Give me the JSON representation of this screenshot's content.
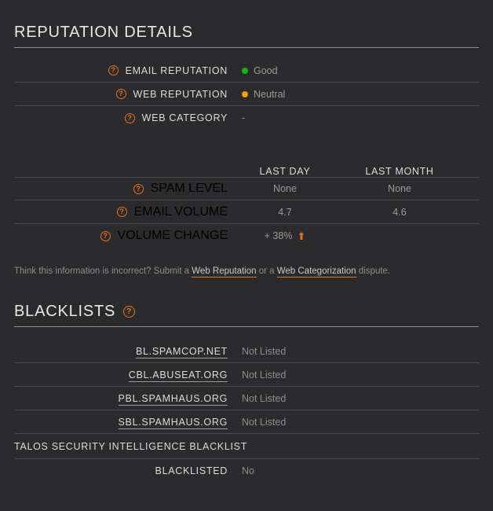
{
  "reputation_section": {
    "title": "REPUTATION DETAILS",
    "help_glyph": "?",
    "rows": [
      {
        "label": "EMAIL REPUTATION",
        "value": "Good",
        "dot_color": "#18b218"
      },
      {
        "label": "WEB REPUTATION",
        "value": "Neutral",
        "dot_color": "#e8a317"
      },
      {
        "label": "WEB CATEGORY",
        "value": "-",
        "dot_color": ""
      }
    ]
  },
  "metrics": {
    "columns": [
      "LAST DAY",
      "LAST MONTH"
    ],
    "rows": [
      {
        "label": "SPAM LEVEL",
        "last_day": "None",
        "last_month": "None",
        "arrow": ""
      },
      {
        "label": "EMAIL VOLUME",
        "last_day": "4.7",
        "last_month": "4.6",
        "arrow": ""
      },
      {
        "label": "VOLUME CHANGE",
        "last_day": "+ 38%",
        "last_month": "",
        "arrow": "⬆"
      }
    ]
  },
  "dispute_note": {
    "prefix": "Think this information is incorrect? Submit a ",
    "link1": "Web Reputation",
    "middle": " or a ",
    "link2": "Web Categorization",
    "suffix": " dispute."
  },
  "blacklists_section": {
    "title": "BLACKLISTS",
    "help_glyph": "?",
    "rows": [
      {
        "name": "BL.SPAMCOP.NET",
        "status": "Not Listed"
      },
      {
        "name": "CBL.ABUSEAT.ORG",
        "status": "Not Listed"
      },
      {
        "name": "PBL.SPAMHAUS.ORG",
        "status": "Not Listed"
      },
      {
        "name": "SBL.SPAMHAUS.ORG",
        "status": "Not Listed"
      }
    ]
  },
  "talos_section": {
    "title": "TALOS SECURITY INTELLIGENCE BLACKLIST",
    "row": {
      "label": "BLACKLISTED",
      "value": "No"
    }
  }
}
